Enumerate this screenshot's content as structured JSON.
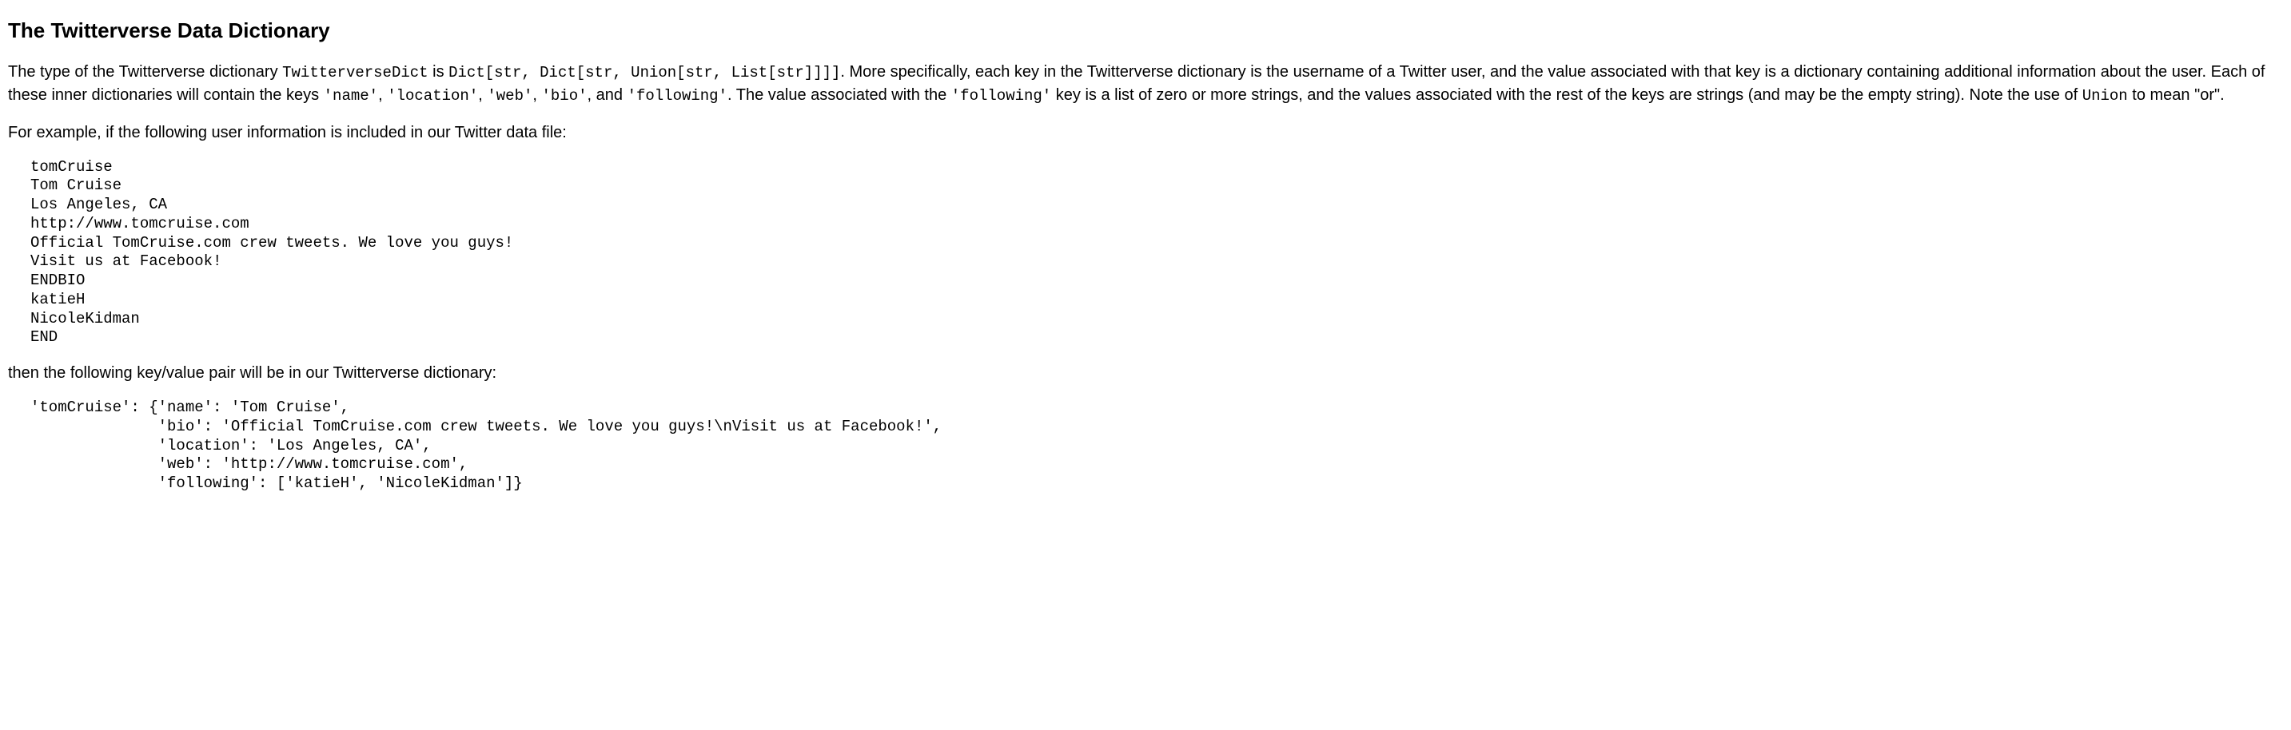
{
  "heading": "The Twitterverse Data Dictionary",
  "para1": {
    "t1": "The type of the Twitterverse dictionary ",
    "c1": "TwitterverseDict",
    "t2": " is ",
    "c2": "Dict[str, Dict[str, Union[str, List[str]]]]",
    "t3": ". More specifically, each key in the Twitterverse dictionary is the username of a Twitter user, and the value associated with that key is a dictionary containing additional information about the user. Each of these inner dictionaries will contain the keys ",
    "c3": "'name'",
    "t4": ", ",
    "c4": "'location'",
    "t5": ", ",
    "c5": "'web'",
    "t6": ", ",
    "c6": "'bio'",
    "t7": ", and ",
    "c7": "'following'",
    "t8": ". The value associated with the ",
    "c8": "'following'",
    "t9": " key is a list of zero or more strings, and the values associated with the rest of the keys are strings (and may be the empty string). Note the use of ",
    "c9": "Union",
    "t10": " to mean \"or\"."
  },
  "para2": "For example, if the following user information is included in our Twitter data file:",
  "code1": "tomCruise\nTom Cruise\nLos Angeles, CA\nhttp://www.tomcruise.com\nOfficial TomCruise.com crew tweets. We love you guys!\nVisit us at Facebook!\nENDBIO\nkatieH\nNicoleKidman\nEND",
  "para3": "then the following key/value pair will be in our Twitterverse dictionary:",
  "code2": "'tomCruise': {'name': 'Tom Cruise',\n              'bio': 'Official TomCruise.com crew tweets. We love you guys!\\nVisit us at Facebook!',\n              'location': 'Los Angeles, CA',\n              'web': 'http://www.tomcruise.com',\n              'following': ['katieH', 'NicoleKidman']}"
}
